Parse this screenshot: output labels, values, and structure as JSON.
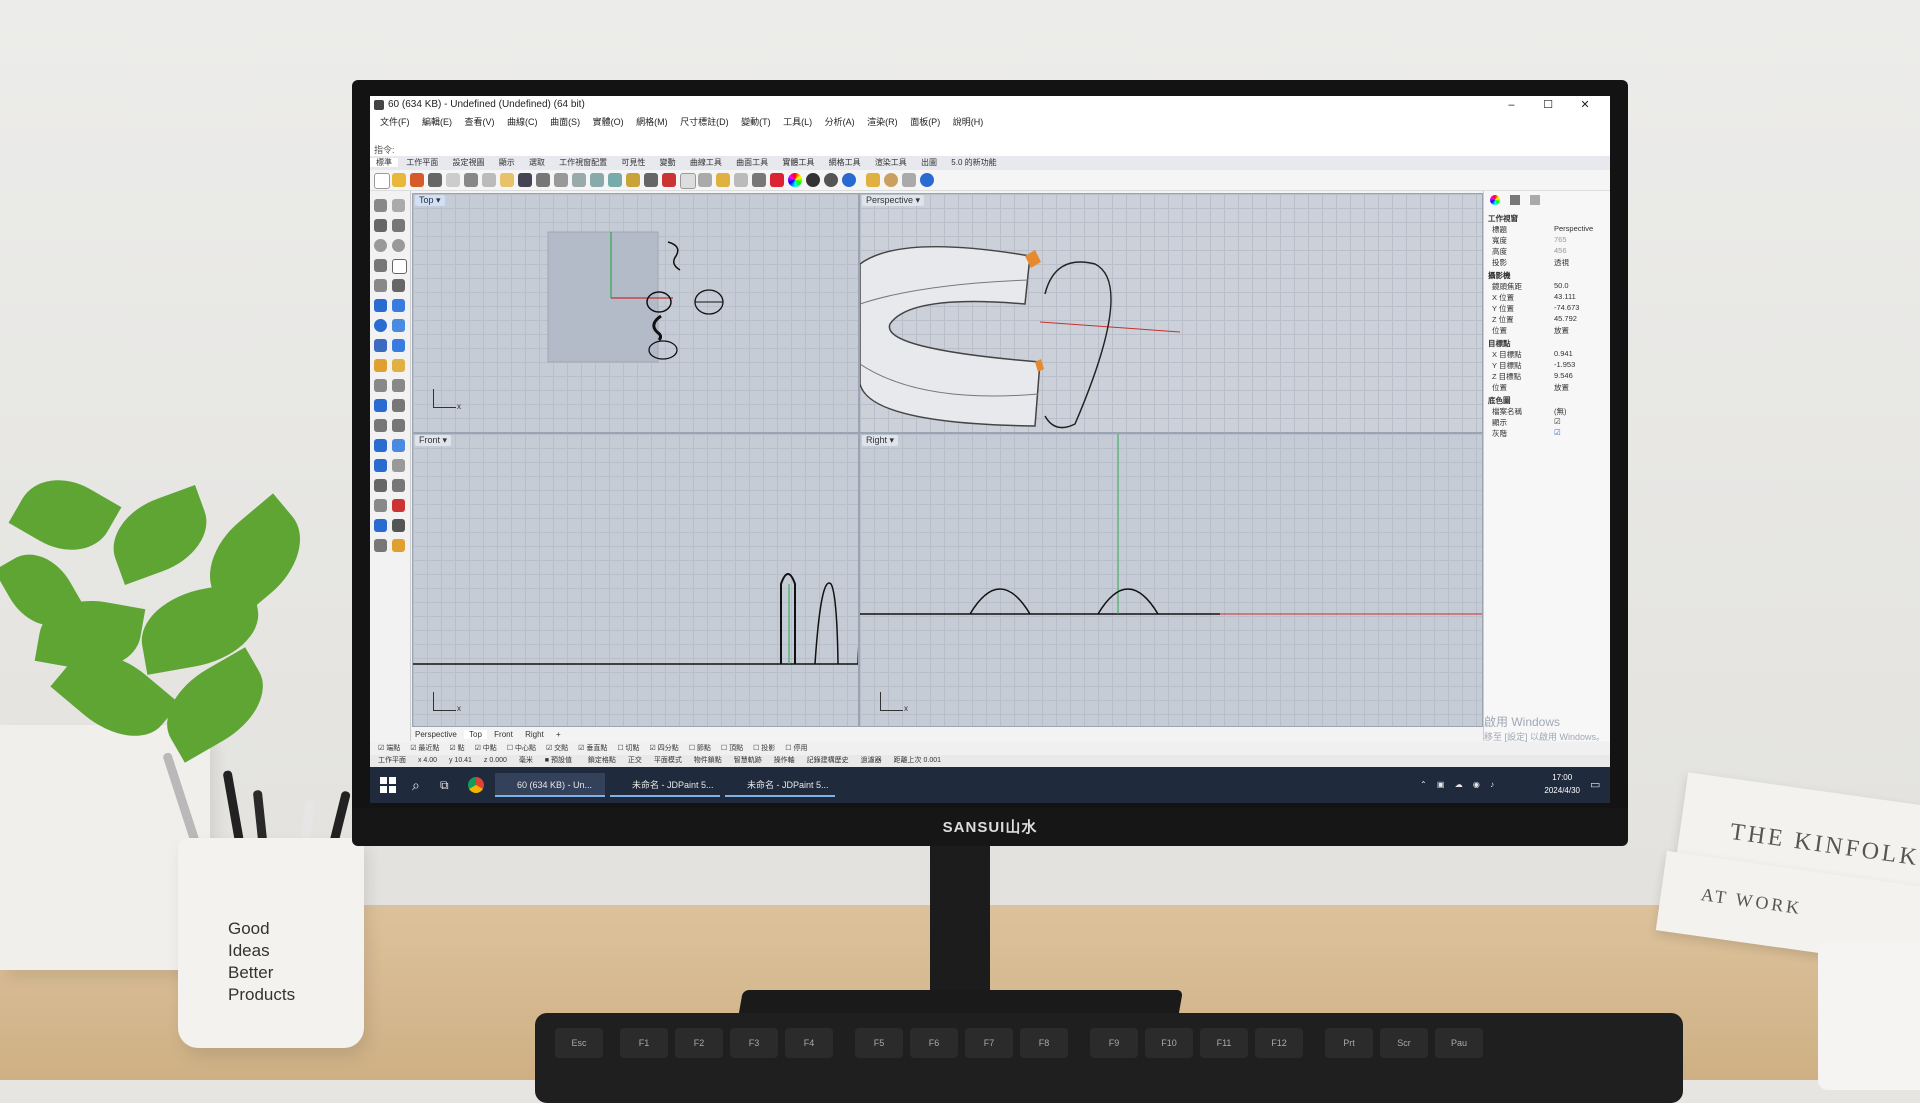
{
  "scene": {
    "pencup_lines": [
      "Good",
      "Ideas",
      "Better",
      "Products"
    ],
    "book_top": "THE KINFOLK",
    "book_bottom": "AT WORK",
    "monitor_brand": "SANSUI山水"
  },
  "window": {
    "title": "60 (634 KB) - Undefined (Undefined) (64 bit)",
    "controls": [
      "–",
      "☐",
      "✕"
    ]
  },
  "menu": [
    "文件(F)",
    "編輯(E)",
    "查看(V)",
    "曲線(C)",
    "曲面(S)",
    "實體(O)",
    "網格(M)",
    "尺寸標註(D)",
    "變動(T)",
    "工具(L)",
    "分析(A)",
    "渲染(R)",
    "面板(P)",
    "說明(H)"
  ],
  "command_prompt": "指令:",
  "ribbon_tabs": [
    "標準",
    "工作平面",
    "設定視圖",
    "顯示",
    "選取",
    "工作視窗配置",
    "可見性",
    "變動",
    "曲線工具",
    "曲面工具",
    "實體工具",
    "網格工具",
    "渲染工具",
    "出圖",
    "5.0 的新功能"
  ],
  "viewports": {
    "top": {
      "label": "Top ▾",
      "axis": "x"
    },
    "perspective": {
      "label": "Perspective ▾"
    },
    "front": {
      "label": "Front ▾",
      "axis": "x"
    },
    "right": {
      "label": "Right ▾",
      "axis": "x"
    }
  },
  "viewport_tabs": [
    "Perspective",
    "Top",
    "Front",
    "Right",
    "+"
  ],
  "properties": {
    "section_view": "工作視窗",
    "rows_view": [
      {
        "k": "標題",
        "v": "Perspective"
      },
      {
        "k": "寬度",
        "v": "765"
      },
      {
        "k": "高度",
        "v": "456"
      },
      {
        "k": "投影",
        "v": "透視"
      }
    ],
    "section_camera": "攝影機",
    "rows_camera": [
      {
        "k": "鏡頭焦距",
        "v": "50.0"
      },
      {
        "k": "X 位置",
        "v": "43.111"
      },
      {
        "k": "Y 位置",
        "v": "-74.673"
      },
      {
        "k": "Z 位置",
        "v": "45.792"
      },
      {
        "k": "位置",
        "v": "放置"
      }
    ],
    "section_target": "目標點",
    "rows_target": [
      {
        "k": "X 目標點",
        "v": "0.941"
      },
      {
        "k": "Y 目標點",
        "v": "-1.953"
      },
      {
        "k": "Z 目標點",
        "v": "9.546"
      },
      {
        "k": "位置",
        "v": "放置"
      }
    ],
    "section_bg": "底色圖",
    "rows_bg": [
      {
        "k": "檔案名稱",
        "v": "(無)"
      },
      {
        "k": "顯示",
        "v": "☑"
      },
      {
        "k": "灰階",
        "v": "☑"
      }
    ]
  },
  "osnap": [
    "端點",
    "最近點",
    "點",
    "中點",
    "中心點",
    "交點",
    "垂直點",
    "切點",
    "四分點",
    "節點",
    "頂點",
    "投影",
    "停用"
  ],
  "status": [
    "工作平面",
    "x 4.00",
    "y 10.41",
    "z 0.000",
    "毫米",
    "■ 預設值",
    "鎖定格點",
    "正交",
    "平面模式",
    "物件鎖點",
    "智慧軌跡",
    "操作軸",
    "記錄建構歷史",
    "過濾器",
    "距離上次 0.001"
  ],
  "watermark": [
    "啟用 Windows",
    "移至 [設定] 以啟用 Windows。"
  ],
  "taskbar": {
    "tasks": [
      "60 (634 KB) - Un...",
      "未命名 - JDPaint 5...",
      "未命名 - JDPaint 5..."
    ],
    "time": "17:00",
    "date": "2024/4/30"
  },
  "colors": {
    "taskbar": "#1f2a3c",
    "viewport": "#c6ccd6",
    "accent": "#2a6bd1"
  }
}
